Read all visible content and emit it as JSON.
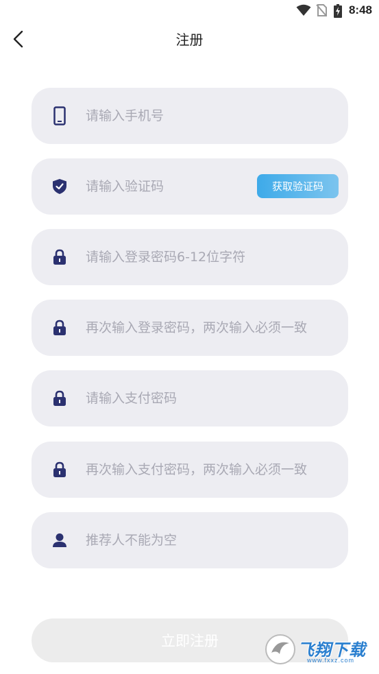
{
  "status_bar": {
    "time": "8:48"
  },
  "nav": {
    "title": "注册"
  },
  "form": {
    "phone_placeholder": "请输入手机号",
    "code_placeholder": "请输入验证码",
    "get_code_label": "获取验证码",
    "password_placeholder": "请输入登录密码6-12位字符",
    "password_confirm_placeholder": "再次输入登录密码，两次输入必须一致",
    "pay_password_placeholder": "请输入支付密码",
    "pay_password_confirm_placeholder": "再次输入支付密码，两次输入必须一致",
    "referrer_placeholder": "推荐人不能为空"
  },
  "register_label": "立即注册",
  "watermark": {
    "text": "飞翔下载",
    "url": "www.fxxz.com"
  },
  "colors": {
    "icon": "#2b3170",
    "field_bg": "#ededf2",
    "accent": "#3eaae9"
  }
}
